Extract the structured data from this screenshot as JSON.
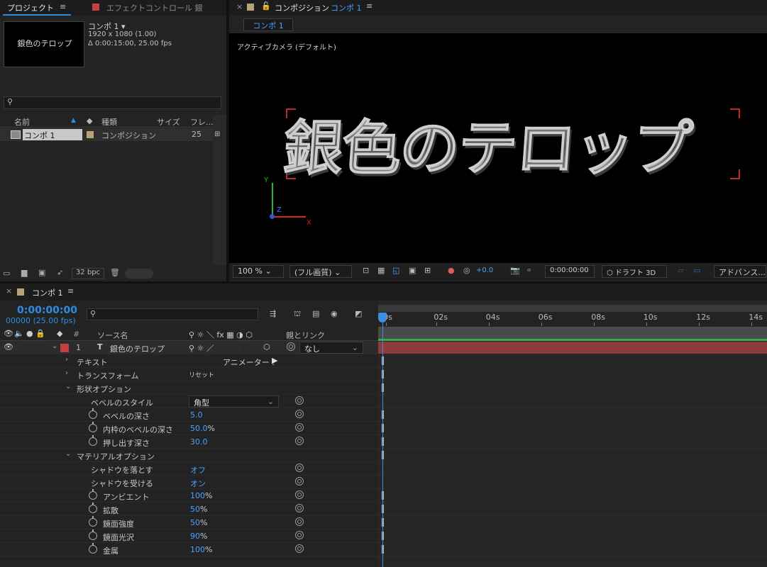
{
  "project_panel": {
    "tab_project": "プロジェクト",
    "tab_effect": "エフェクトコントロール 銀",
    "comp_name": "コンポ 1 ▾",
    "comp_size": "1920 x 1080 (1.00)",
    "comp_duration": "Δ 0:00:15:00, 25.00 fps",
    "thumb_text": "銀色のテロップ",
    "columns": {
      "name": "名前",
      "type": "種類",
      "size": "サイズ",
      "frame": "フレ..."
    },
    "row": {
      "name": "コンポ 1",
      "type": "コンポジション",
      "frame": "25"
    },
    "bpc": "32 bpc"
  },
  "comp_panel": {
    "title": "コンポジション",
    "title_name": "コンポ 1",
    "tab": "コンポ 1",
    "camera_label": "アクティブカメラ (デフォルト)",
    "main_text": "銀色のテロップ",
    "axis_y": "Y",
    "axis_z": "Z",
    "axis_x": "X",
    "zoom": "100 %",
    "quality": "(フル画質)",
    "exposure": "+0.0",
    "timecode": "0:00:00:00",
    "draft3d": "ドラフト 3D",
    "advanced": "アドバンス..."
  },
  "timeline": {
    "tab": "コンポ 1",
    "timecode": "0:00:00:00",
    "frames": "00000 (25.00 fps)",
    "col_source": "ソース名",
    "col_parent": "親とリンク",
    "layer_num": "1",
    "layer_name": "銀色のテロップ",
    "parent_value": "なし",
    "ruler_labels": [
      "0s",
      "02s",
      "04s",
      "06s",
      "08s",
      "10s",
      "12s",
      "14s"
    ],
    "ruler_positions": [
      0.013,
      0.143,
      0.277,
      0.412,
      0.548,
      0.682,
      0.818,
      0.953
    ],
    "rows": {
      "text": "テキスト",
      "animator": "アニメーター :",
      "transform": "トランスフォーム",
      "reset": "リセット",
      "shape_options": "形状オプション",
      "bevel_style": "ベベルのスタイル",
      "bevel_style_val": "角型",
      "bevel_depth": "ベベルの深さ",
      "bevel_depth_val": "5.0",
      "inner_bevel": "内枠のベベルの深さ",
      "inner_bevel_val": "50.0",
      "extrusion": "押し出す深さ",
      "extrusion_val": "30.0",
      "material_options": "マテリアルオプション",
      "cast_shadow": "シャドウを落とす",
      "cast_shadow_val": "オフ",
      "accept_shadow": "シャドウを受ける",
      "accept_shadow_val": "オン",
      "ambient": "アンビエント",
      "ambient_val": "100",
      "diffuse": "拡散",
      "diffuse_val": "50",
      "spec_intensity": "鏡面強度",
      "spec_intensity_val": "50",
      "spec_shininess": "鏡面光沢",
      "spec_shininess_val": "90",
      "metal": "金属",
      "metal_val": "100",
      "pct": "%"
    }
  }
}
